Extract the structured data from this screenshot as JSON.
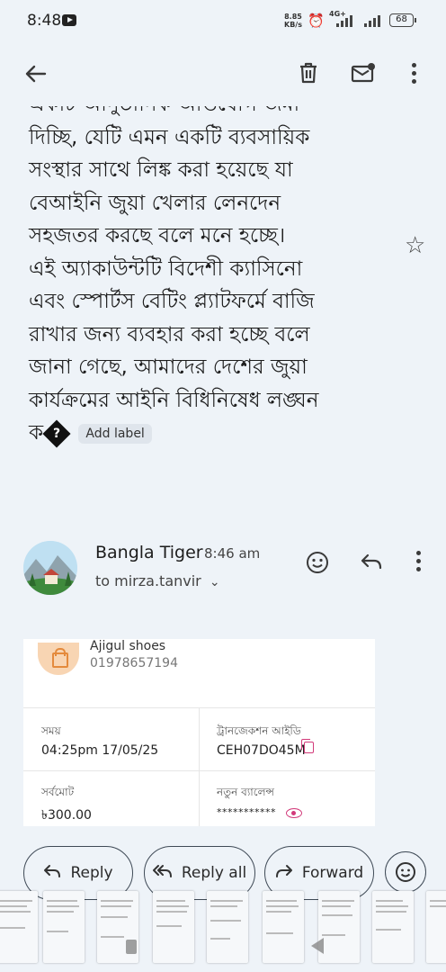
{
  "status_bar": {
    "time": "8:48",
    "speed_value": "8.85",
    "speed_unit": "KB/s",
    "network": "4G+",
    "battery": "68"
  },
  "email": {
    "body_lines": [
      "একটি আনুষ্ঠানিক অভিযোগ জমা",
      "দিচ্ছি, যেটি এমন একটি ব্যবসায়িক",
      "সংস্থার সাথে লিঙ্ক করা হয়েছে যা",
      "বেআইনি জুয়া খেলার লেনদেন",
      "সহজতর করছে বলে মনে হচ্ছে।",
      "এই অ্যাকাউন্টটি বিদেশী ক্যাসিনো",
      "এবং স্পোর্টস বেটিং প্ল্যাটফর্মে বাজি",
      "রাখার জন্য ব্যবহার করা হচ্ছে বলে",
      "জানা গেছে, আমাদের দেশের জুয়া",
      "কার্যক্রমের আইনি বিধিনিষেধ লঙ্ঘন"
    ],
    "last_line_prefix": "ক",
    "unknown_glyph": "?",
    "add_label": "Add label"
  },
  "sender": {
    "name": "Bangla Tiger",
    "time": "8:46 am",
    "to": "to mirza.tanvir"
  },
  "receipt": {
    "shop_name": "Ajigul shoes",
    "shop_phone": "01978657194",
    "time_label": "সময়",
    "time_value": "04:25pm 17/05/25",
    "txn_label": "ট্রানজেকশন আইডি",
    "txn_value": "CEH07DO45M",
    "total_label": "সর্বমোট",
    "total_value": "৳300.00",
    "new_balance_label": "নতুন ব্যালেন্স",
    "new_balance_value": "***********"
  },
  "actions": {
    "reply": "Reply",
    "reply_all": "Reply all",
    "forward": "Forward"
  },
  "icons": [
    "back-arrow-icon",
    "trash-icon",
    "mark-unread-icon",
    "more-vert-icon",
    "star-icon",
    "emoji-icon",
    "reply-icon",
    "reply-all-icon",
    "forward-icon",
    "copy-icon",
    "eye-icon",
    "chevron-down-icon"
  ],
  "colors": {
    "background": "#eef3f8",
    "accent_pink": "#d23a7a",
    "shop_icon_bg": "#f8d5b3"
  }
}
